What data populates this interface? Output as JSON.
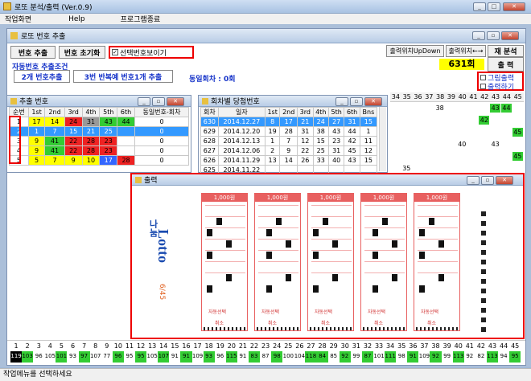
{
  "app": {
    "title": "로또 분석/출력 (Ver.0.9)",
    "menu": [
      "작업화면",
      "Help",
      "프로그램종료"
    ]
  },
  "main": {
    "title": "로또 번호 추출",
    "btn_extract": "번호 추출",
    "btn_reset": "번호 초기화",
    "chk_show": "선택번호보이기",
    "label_auto": "자동번호 추출조건",
    "cond1": "2개 번호추출",
    "cond2": "3번 반복예 번호1개 추출",
    "same_round": "동일회차 : 0회",
    "pos_updown": "출력위치UpDown",
    "pos_lr": "출력위치←→",
    "round": "631회",
    "reanalyze": "재 분석",
    "print": "출 력",
    "chk_image": "그림출력",
    "chk_print": "출력하기"
  },
  "extract_win": {
    "title": "추출 번호",
    "headers": [
      "순번",
      "1st",
      "2nd",
      "3rd",
      "4th",
      "5th",
      "6th",
      "동일번호-회차"
    ],
    "rows": [
      {
        "cells": [
          "1",
          "17",
          "14",
          "24",
          "31",
          "43",
          "44",
          "0"
        ],
        "colors": [
          "",
          "c-y",
          "c-y",
          "c-r",
          "c-gr",
          "c-g",
          "c-g",
          ""
        ]
      },
      {
        "cells": [
          "2",
          "1",
          "7",
          "15",
          "21",
          "25",
          "",
          "0"
        ],
        "colors": [
          "",
          "",
          "",
          "",
          "",
          "",
          "",
          ""
        ],
        "sel": true
      },
      {
        "cells": [
          "3",
          "9",
          "41",
          "22",
          "28",
          "23",
          "",
          "0"
        ],
        "colors": [
          "",
          "c-y",
          "c-g",
          "c-r",
          "c-r",
          "c-r",
          "",
          ""
        ]
      },
      {
        "cells": [
          "4",
          "9",
          "41",
          "22",
          "28",
          "23",
          "",
          "0"
        ],
        "colors": [
          "",
          "c-y",
          "c-g",
          "c-r",
          "c-r",
          "c-r",
          "",
          ""
        ]
      },
      {
        "cells": [
          "5",
          "5",
          "7",
          "9",
          "10",
          "17",
          "28",
          "0"
        ],
        "colors": [
          "",
          "c-y",
          "c-y",
          "c-y",
          "c-y",
          "c-b",
          "c-r",
          ""
        ]
      }
    ]
  },
  "winning_win": {
    "title": "회차별 당첨번호",
    "headers": [
      "회차",
      "일자",
      "1st",
      "2nd",
      "3rd",
      "4th",
      "5th",
      "6th",
      "Bns"
    ],
    "rows": [
      [
        "630",
        "2014.12.27",
        "8",
        "17",
        "21",
        "24",
        "27",
        "31",
        "15"
      ],
      [
        "629",
        "2014.12.20",
        "19",
        "28",
        "31",
        "38",
        "43",
        "44",
        "1"
      ],
      [
        "628",
        "2014.12.13",
        "1",
        "7",
        "12",
        "15",
        "23",
        "42",
        "11"
      ],
      [
        "627",
        "2014.12.06",
        "2",
        "9",
        "22",
        "25",
        "31",
        "45",
        "12"
      ],
      [
        "626",
        "2014.11.29",
        "13",
        "14",
        "26",
        "33",
        "40",
        "43",
        "15"
      ],
      [
        "625",
        "2014.11.22",
        "",
        "",
        "",
        "",
        "",
        "",
        ""
      ]
    ]
  },
  "grid": {
    "headers": [
      "34",
      "35",
      "36",
      "37",
      "38",
      "39",
      "40",
      "41",
      "42",
      "43",
      "44",
      "45"
    ],
    "marks": [
      {
        "col": 4,
        "row": 1,
        "v": "38",
        "c": ""
      },
      {
        "col": 9,
        "row": 1,
        "v": "43",
        "c": "c-g"
      },
      {
        "col": 10,
        "row": 1,
        "v": "44",
        "c": "c-g"
      },
      {
        "col": 8,
        "row": 2,
        "v": "42",
        "c": "c-g"
      },
      {
        "col": 11,
        "row": 3,
        "v": "45",
        "c": "c-g"
      },
      {
        "col": 6,
        "row": 4,
        "v": "40",
        "c": ""
      },
      {
        "col": 9,
        "row": 4,
        "v": "43",
        "c": ""
      },
      {
        "col": 11,
        "row": 5,
        "v": "45",
        "c": "c-g"
      },
      {
        "col": 1,
        "row": 6,
        "v": "35",
        "c": ""
      }
    ]
  },
  "print_win": {
    "title": "출력",
    "slip_head": "1,000원",
    "auto_label": "자동선택",
    "cancel_label": "취소",
    "brand_top": "나눔",
    "brand_main": "Lotto",
    "brand_sub": "6/45"
  },
  "bottom": {
    "numbers": [
      "1",
      "2",
      "3",
      "4",
      "5",
      "6",
      "7",
      "8",
      "9",
      "10",
      "11",
      "12",
      "13",
      "14",
      "15",
      "16",
      "17",
      "18",
      "19",
      "20",
      "21",
      "22",
      "23",
      "24",
      "25",
      "26",
      "27",
      "28",
      "29",
      "30",
      "31",
      "32",
      "33",
      "34",
      "35",
      "36",
      "37",
      "38",
      "39",
      "40",
      "41",
      "42",
      "43",
      "44",
      "45"
    ],
    "counts": [
      "119",
      "103",
      "96",
      "105",
      "101",
      "93",
      "97",
      "107",
      "77",
      "96",
      "95",
      "95",
      "105",
      "107",
      "91",
      "91",
      "109",
      "93",
      "96",
      "115",
      "91",
      "83",
      "87",
      "98",
      "100",
      "104",
      "118",
      "84",
      "85",
      "92",
      "99",
      "87",
      "101",
      "111",
      "98",
      "91",
      "109",
      "92",
      "99",
      "113",
      "92",
      "82",
      "113",
      "94",
      "95"
    ]
  },
  "status": "작업메뉴를 선택하세요"
}
